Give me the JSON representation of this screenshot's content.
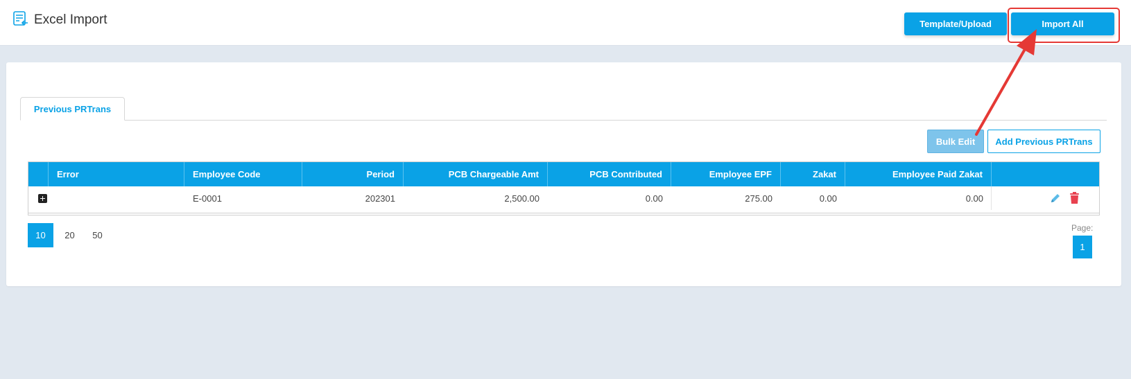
{
  "header": {
    "title": "Excel Import",
    "template_upload_label": "Template/Upload",
    "import_all_label": "Import All"
  },
  "tabs": [
    {
      "label": "Previous PRTrans",
      "active": true
    }
  ],
  "toolbar": {
    "bulk_edit_label": "Bulk Edit",
    "add_label": "Add Previous PRTrans"
  },
  "table": {
    "columns": [
      "",
      "Error",
      "Employee Code",
      "Period",
      "PCB Chargeable Amt",
      "PCB Contributed",
      "Employee EPF",
      "Zakat",
      "Employee Paid Zakat",
      ""
    ],
    "rows": [
      {
        "error": "",
        "employee_code": "E-0001",
        "period": "202301",
        "pcb_chargeable_amt": "2,500.00",
        "pcb_contributed": "0.00",
        "employee_epf": "275.00",
        "zakat": "0.00",
        "employee_paid_zakat": "0.00"
      }
    ]
  },
  "pager": {
    "sizes": [
      "10",
      "20",
      "50"
    ],
    "active_size": "10",
    "page_label": "Page:",
    "current_page": "1"
  },
  "colors": {
    "accent": "#0aa2e6",
    "annotation": "#e53935",
    "delete": "#e8414f"
  },
  "icons": {
    "app": "excel-import-icon",
    "expand": "expand-plus-icon",
    "edit": "pencil-icon",
    "delete": "trash-icon"
  }
}
